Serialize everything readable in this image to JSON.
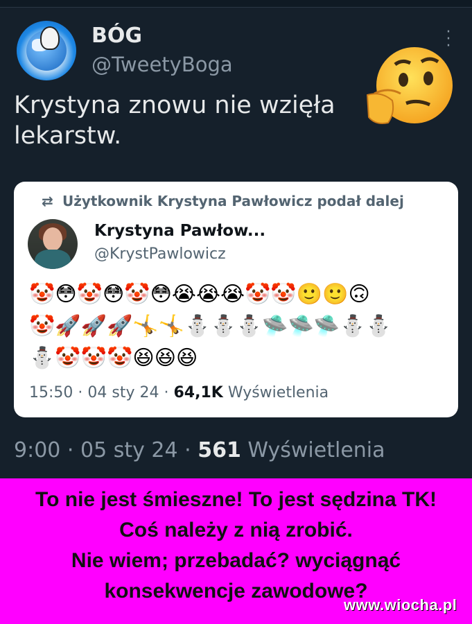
{
  "tweet": {
    "author_name": "BÓG",
    "author_handle": "@TweetyBoga",
    "text_line1": "Krystyna znowu nie wzięła",
    "text_line2": "lekarstw.",
    "menu_icon": "more-vertical-icon",
    "time": "9:00",
    "date": "05 sty 24",
    "views_count": "561",
    "views_label": "Wyświetlenia"
  },
  "quoted": {
    "retweet_label": "Użytkownik Krystyna Pawłowicz podał dalej",
    "author_name": "Krystyna Pawłow...",
    "author_handle": "@KrystPawlowicz",
    "emoji_rows": [
      "🤡😳🤡😳🤡😳😭😭😭🤡🤡🙂🙂🙃",
      "🤡🚀🚀🚀🤸🤸⛄⛄⛄🛸🛸🛸⛄⛄",
      "⛄🤡🤡🤡😆😆😆"
    ],
    "time": "15:50",
    "date": "04 sty 24",
    "views_count": "64,1K",
    "views_label": "Wyświetlenia"
  },
  "decoration": {
    "thinking_emoji": "thinking-face-icon"
  },
  "banner": {
    "line1": "To nie jest śmieszne!  To jest sędzina TK!",
    "line2": "Coś należy z nią zrobić.",
    "line3": "Nie wiem; przebadać? wyciągnąć",
    "line4": "konsekwencje zawodowe?",
    "color": "#ff00ff"
  },
  "watermark": "www.wiocha.pl"
}
